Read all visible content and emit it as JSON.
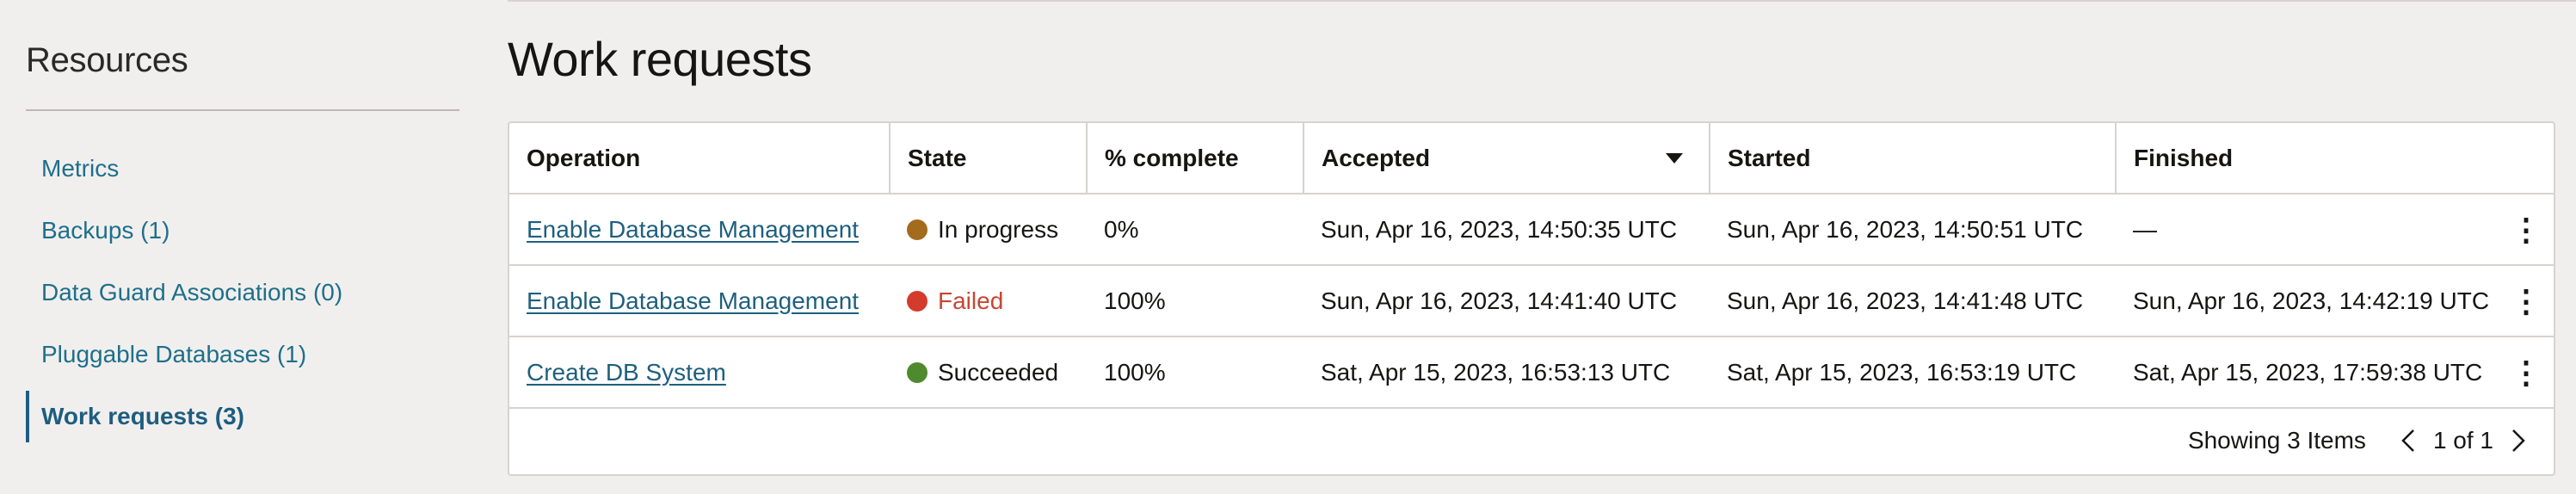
{
  "sidebar": {
    "title": "Resources",
    "items": [
      {
        "label": "Metrics"
      },
      {
        "label": "Backups (1)"
      },
      {
        "label": "Data Guard Associations (0)"
      },
      {
        "label": "Pluggable Databases (1)"
      },
      {
        "label": "Work requests (3)"
      }
    ],
    "active_index": 4
  },
  "main": {
    "title": "Work requests",
    "table": {
      "columns": [
        "Operation",
        "State",
        "% complete",
        "Accepted",
        "Started",
        "Finished"
      ],
      "sorted_column": "Accepted",
      "sort_direction": "descending",
      "rows": [
        {
          "operation": "Enable Database Management",
          "state": "In progress",
          "state_color": "#a36b1e",
          "percent": "0%",
          "accepted": "Sun, Apr 16, 2023, 14:50:35 UTC",
          "started": "Sun, Apr 16, 2023, 14:50:51 UTC",
          "finished": "—"
        },
        {
          "operation": "Enable Database Management",
          "state": "Failed",
          "state_color": "#d43b2c",
          "percent": "100%",
          "accepted": "Sun, Apr 16, 2023, 14:41:40 UTC",
          "started": "Sun, Apr 16, 2023, 14:41:48 UTC",
          "finished": "Sun, Apr 16, 2023, 14:42:19 UTC"
        },
        {
          "operation": "Create DB System",
          "state": "Succeeded",
          "state_color": "#4f8a2e",
          "percent": "100%",
          "accepted": "Sat, Apr 15, 2023, 16:53:13 UTC",
          "started": "Sat, Apr 15, 2023, 16:53:19 UTC",
          "finished": "Sat, Apr 15, 2023, 17:59:38 UTC"
        }
      ]
    },
    "footer": {
      "showing": "Showing 3 Items",
      "page": "1 of 1"
    }
  },
  "colors": {
    "link": "#1e5f7d",
    "background": "#f1efed",
    "failed_text": "#c74634"
  }
}
